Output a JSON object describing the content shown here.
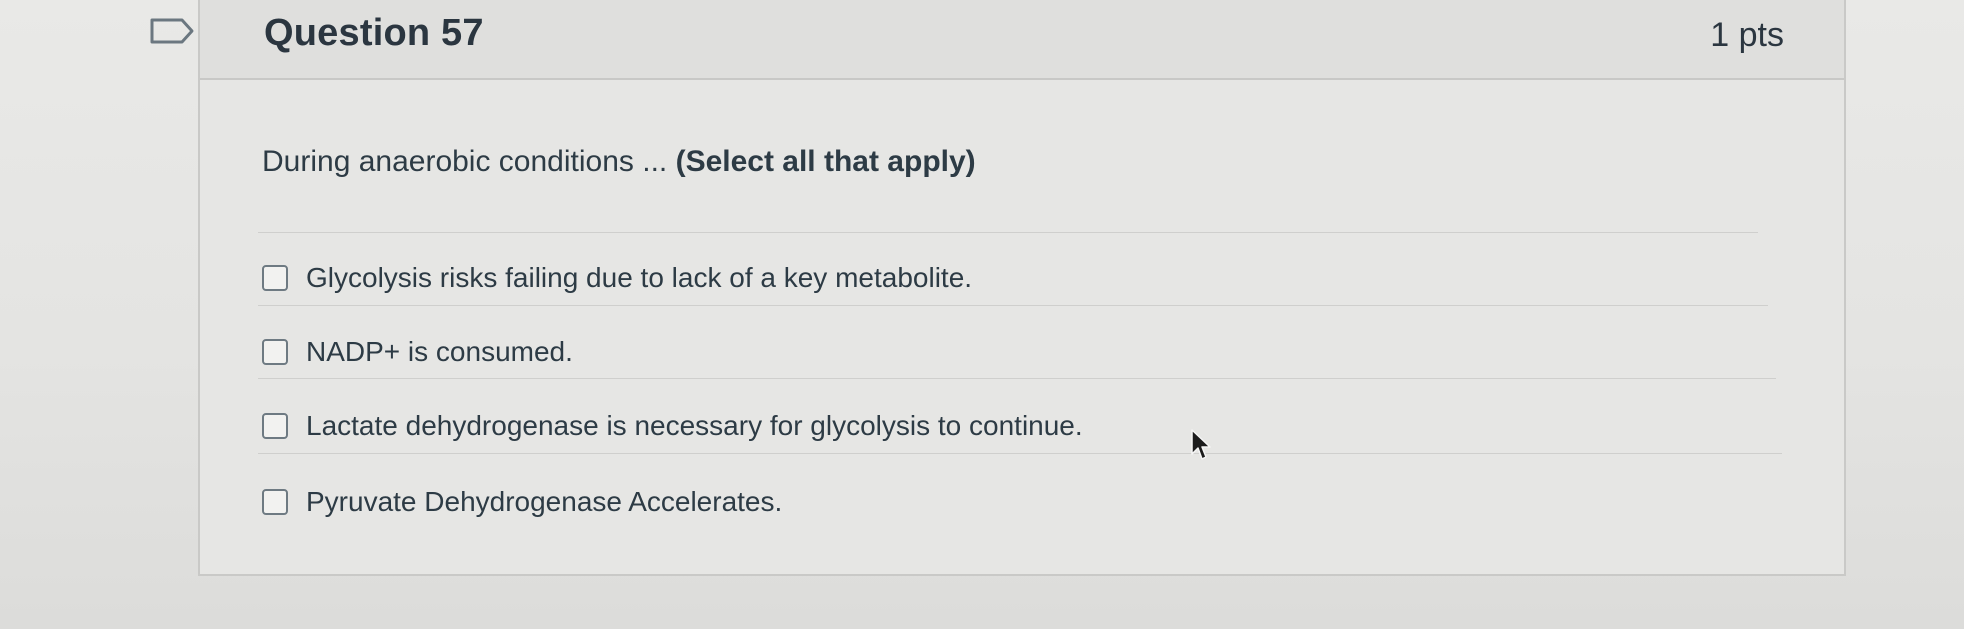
{
  "question": {
    "title": "Question 57",
    "points": "1 pts",
    "prompt": "During anaerobic conditions ...",
    "instruction": "(Select all that apply)"
  },
  "answers": [
    {
      "label": "Glycolysis risks failing due to lack of a key metabolite.",
      "checked": false
    },
    {
      "label": "NADP+ is consumed.",
      "checked": false
    },
    {
      "label": "Lactate dehydrogenase is necessary for glycolysis to continue.",
      "checked": false
    },
    {
      "label": "Pyruvate Dehydrogenase Accelerates.",
      "checked": false
    }
  ],
  "icons": {
    "flag": "bookmark-flag-icon",
    "cursor": "mouse-pointer-icon"
  }
}
